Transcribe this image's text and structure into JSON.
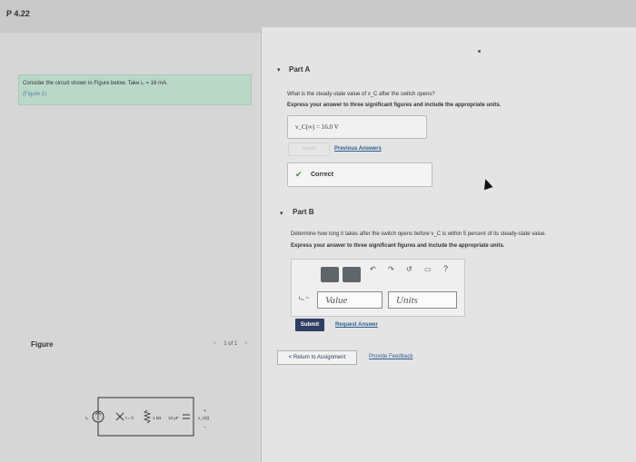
{
  "header": {
    "problem_id": "P 4.22"
  },
  "left": {
    "intro_text": "Consider the circuit shown in Figure below. Take i₀ = 16 mA.",
    "intro_link": "(Figure 1)",
    "figure_label": "Figure",
    "figure_nav": {
      "prev": "<",
      "page": "1 of 1",
      "next": ">"
    },
    "circuit_labels": {
      "source": "i₀",
      "switch": "t = 0",
      "resistor": "1 kΩ",
      "capacitor": "10 μF",
      "vc": "v_C(t)"
    }
  },
  "part_a": {
    "title": "Part A",
    "question": "What is the steady-state value of v_C after the switch opens?",
    "instruction": "Express your answer to three significant figures and include the appropriate units.",
    "answer": "v_C(∞) =  16.0 V",
    "submit_label": "Submit",
    "previous_answers": "Previous Answers",
    "result": "Correct"
  },
  "part_b": {
    "title": "Part B",
    "question": "Determine how long it takes after the switch opens before v_C is within 5 percent of its steady-state value.",
    "instruction": "Express your answer to three significant figures and include the appropriate units.",
    "var_label": "t₉₅ =",
    "value_placeholder": "Value",
    "units_placeholder": "Units",
    "toolbar": [
      "templates-icon",
      "units-icon",
      "undo-icon",
      "redo-icon",
      "reset-icon",
      "keyboard-icon",
      "help-icon"
    ],
    "help_glyph": "?",
    "submit_label": "Submit",
    "request_answer": "Request Answer"
  },
  "footer": {
    "return_label": "< Return to Assignment",
    "feedback_label": "Provide Feedback"
  },
  "colors": {
    "intro_bg": "#b9d8c8",
    "submit_bg": "#2f3f64",
    "link": "#2f5d8c",
    "correct_check": "#3b8a3b"
  }
}
